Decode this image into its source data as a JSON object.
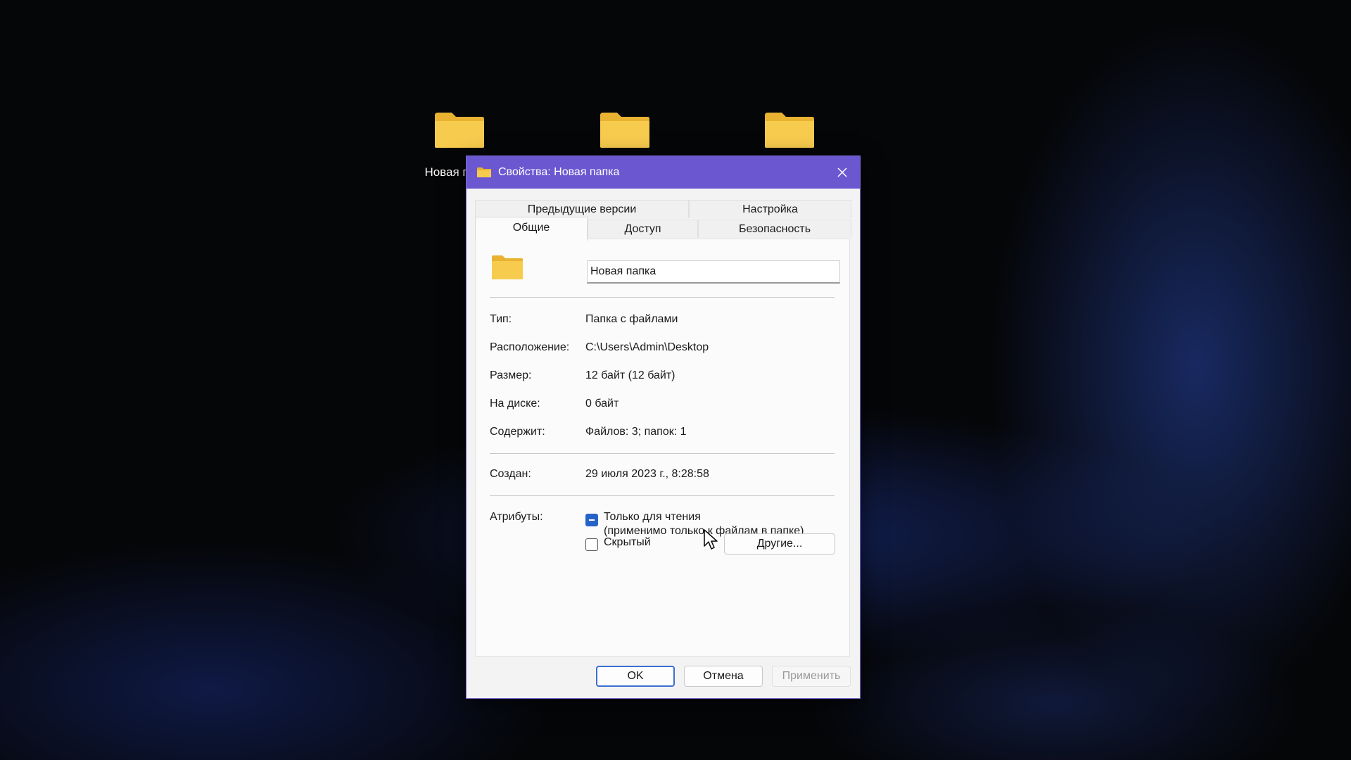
{
  "desktop": {
    "icons": [
      {
        "label": "Новая папка"
      },
      {
        "label": ""
      },
      {
        "label": ""
      }
    ]
  },
  "dialog": {
    "title": "Свойства: Новая папка",
    "tabs_row1": [
      "Предыдущие версии",
      "Настройка"
    ],
    "tabs_row2": [
      "Общие",
      "Доступ",
      "Безопасность"
    ],
    "active_tab": "Общие",
    "name_value": "Новая папка",
    "properties": {
      "type_label": "Тип:",
      "type_value": "Папка с файлами",
      "location_label": "Расположение:",
      "location_value": "C:\\Users\\Admin\\Desktop",
      "size_label": "Размер:",
      "size_value": "12 байт (12 байт)",
      "ondisk_label": "На диске:",
      "ondisk_value": "0 байт",
      "contains_label": "Содержит:",
      "contains_value": "Файлов: 3; папок: 1",
      "created_label": "Создан:",
      "created_value": "29 июля 2023 г., 8:28:58"
    },
    "attributes": {
      "label": "Атрибуты:",
      "readonly_line1": "Только для чтения",
      "readonly_line2": "(применимо только к файлам в папке)",
      "readonly_state": "mixed",
      "hidden_label": "Скрытый",
      "hidden_state": "unchecked",
      "advanced_button": "Другие..."
    },
    "buttons": {
      "ok": "OK",
      "cancel": "Отмена",
      "apply": "Применить"
    }
  },
  "colors": {
    "titlebar": "#6b58d0",
    "folder": "#f5c842",
    "checkbox_accent": "#2563c9",
    "ok_border": "#3b6fd1"
  }
}
